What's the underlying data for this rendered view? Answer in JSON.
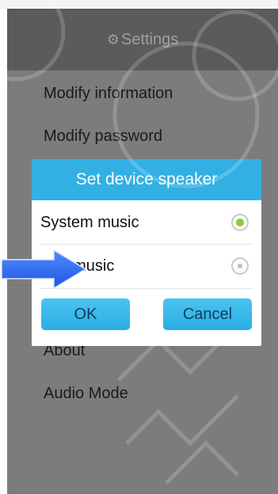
{
  "header": {
    "title": "Settings",
    "icon": "gear-icon"
  },
  "menu": {
    "items": [
      {
        "label": "Modify information"
      },
      {
        "label": "Modify password"
      },
      {
        "label": "About"
      },
      {
        "label": "Audio Mode"
      }
    ]
  },
  "dialog": {
    "title": "Set device speaker",
    "options": [
      {
        "label": "System music",
        "checked": true
      },
      {
        "label": "App music",
        "checked": false
      }
    ],
    "ok_label": "OK",
    "cancel_label": "Cancel"
  },
  "colors": {
    "accent": "#33b0e3",
    "radio_checked": "#88cc33",
    "arrow": "#2f6fff"
  }
}
